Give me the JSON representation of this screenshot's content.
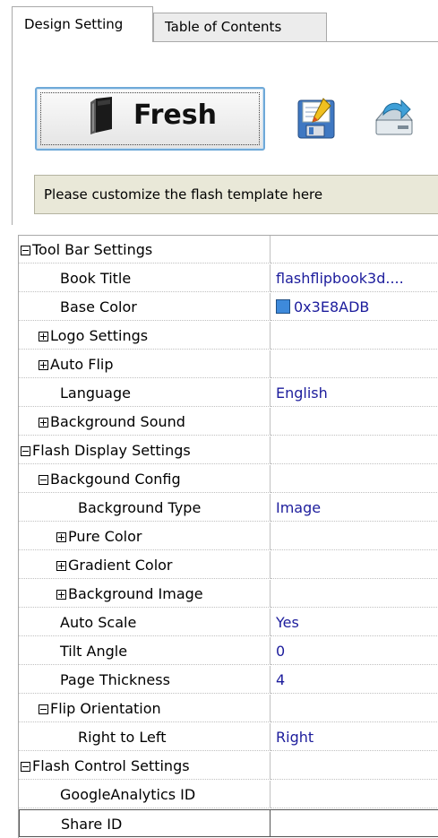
{
  "tabs": [
    {
      "label": "Design Setting",
      "active": true
    },
    {
      "label": "Table of Contents",
      "active": false
    }
  ],
  "toolbar": {
    "fresh_label": "Fresh",
    "fresh_icon": "book-icon",
    "save_icon": "save-edit-icon",
    "share_icon": "share-export-icon"
  },
  "hint": "Please customize the flash template here",
  "colors": {
    "base_color_swatch": "#3E8ADB",
    "value_text": "#1C1C9C",
    "hint_bg": "#E9E8D8"
  },
  "properties": [
    {
      "label": "Tool Bar Settings",
      "value": "",
      "toggle": "minus",
      "indent": 0
    },
    {
      "label": "Book Title",
      "value": "flashflipbook3d....",
      "toggle": "",
      "indent": 1
    },
    {
      "label": "Base Color",
      "value": "0x3E8ADB",
      "toggle": "",
      "indent": 1,
      "swatch": true
    },
    {
      "label": "Logo Settings",
      "value": "",
      "toggle": "plus",
      "indent": 1
    },
    {
      "label": "Auto Flip",
      "value": "",
      "toggle": "plus",
      "indent": 1
    },
    {
      "label": "Language",
      "value": "English",
      "toggle": "",
      "indent": 1
    },
    {
      "label": "Background Sound",
      "value": "",
      "toggle": "plus",
      "indent": 1
    },
    {
      "label": "Flash Display Settings",
      "value": "",
      "toggle": "minus",
      "indent": 0
    },
    {
      "label": "Backgound Config",
      "value": "",
      "toggle": "minus",
      "indent": 1
    },
    {
      "label": "Background Type",
      "value": "Image",
      "toggle": "",
      "indent": 2
    },
    {
      "label": "Pure Color",
      "value": "",
      "toggle": "plus",
      "indent": 2
    },
    {
      "label": "Gradient Color",
      "value": "",
      "toggle": "plus",
      "indent": 2
    },
    {
      "label": "Background Image",
      "value": "",
      "toggle": "plus",
      "indent": 2
    },
    {
      "label": "Auto Scale",
      "value": "Yes",
      "toggle": "",
      "indent": 1
    },
    {
      "label": "Tilt Angle",
      "value": "0",
      "toggle": "",
      "indent": 1
    },
    {
      "label": "Page Thickness",
      "value": "4",
      "toggle": "",
      "indent": 1
    },
    {
      "label": "Flip Orientation",
      "value": "",
      "toggle": "minus",
      "indent": 1
    },
    {
      "label": "Right to Left",
      "value": "Right",
      "toggle": "",
      "indent": 2
    },
    {
      "label": "Flash Control Settings",
      "value": "",
      "toggle": "minus",
      "indent": 0
    },
    {
      "label": "GoogleAnalytics ID",
      "value": "",
      "toggle": "",
      "indent": 1
    },
    {
      "label": "Share ID",
      "value": "",
      "toggle": "",
      "indent": 1,
      "selected": true
    }
  ]
}
